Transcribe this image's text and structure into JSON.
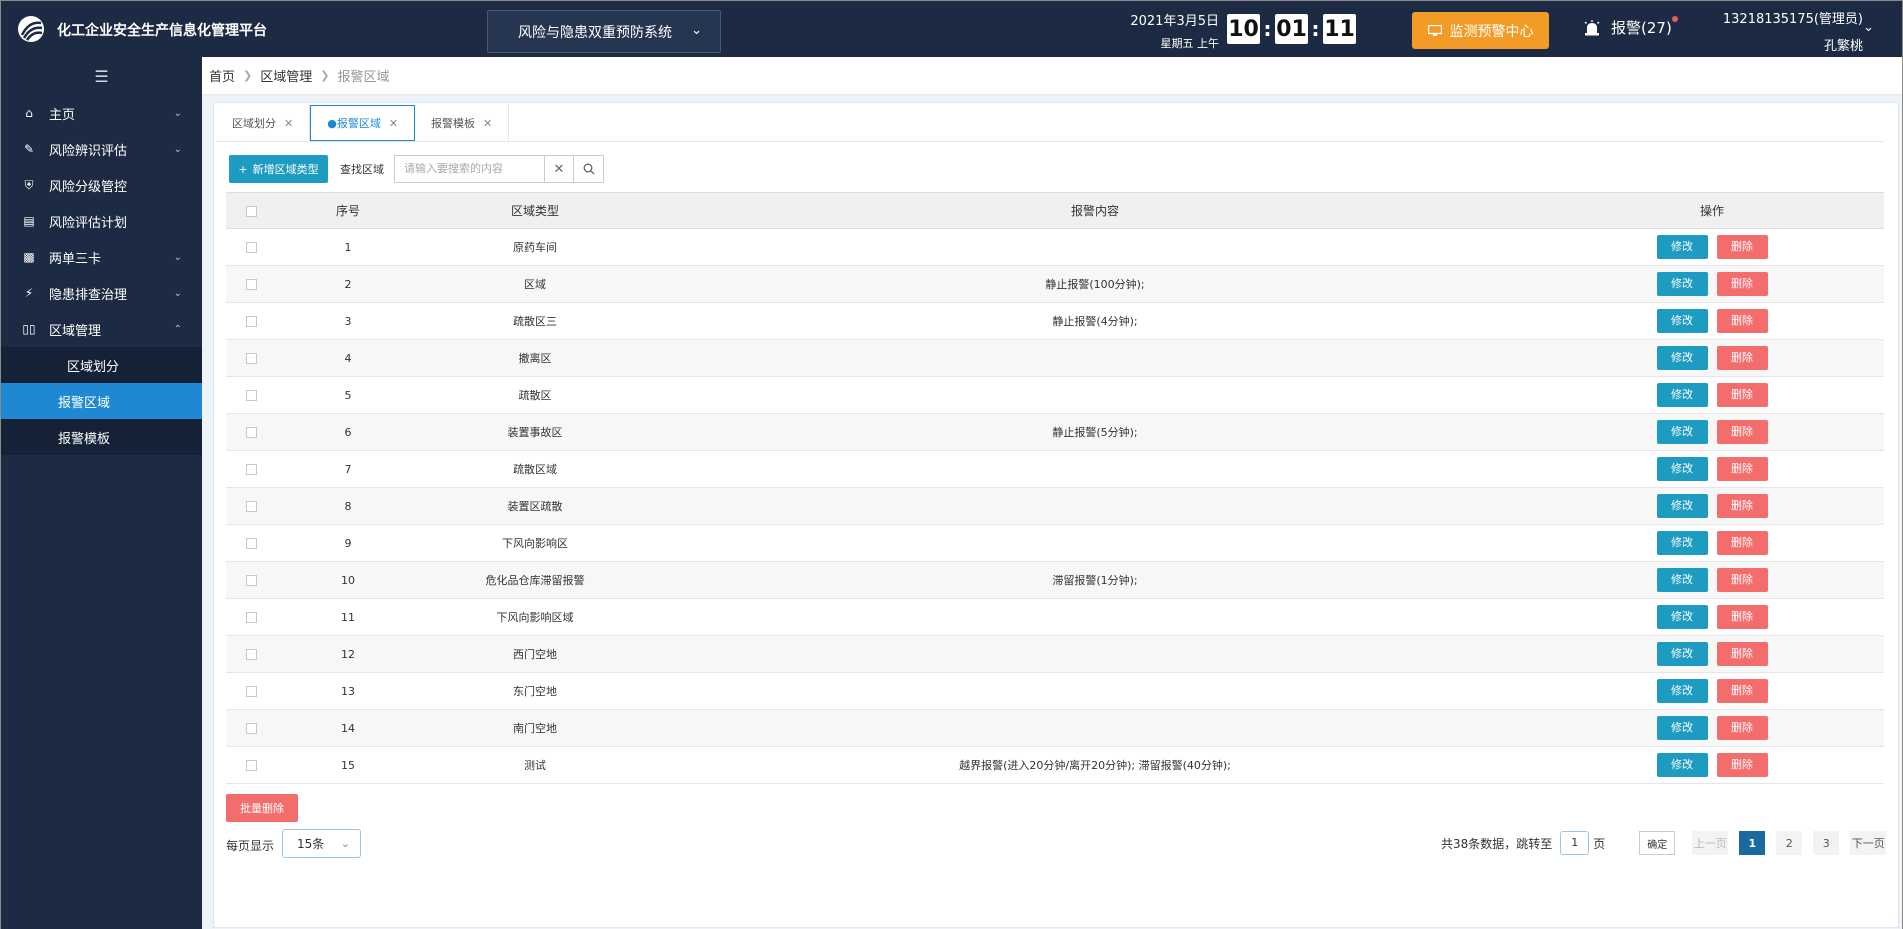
{
  "header": {
    "app_title": "化工企业安全生产信息化管理平台",
    "system_select": "风险与隐患双重预防系统",
    "date": "2021年3月5日",
    "weekday": "星期五 上午",
    "clock": {
      "h": "10",
      "m": "01",
      "s": "11"
    },
    "monitor_button": "监测预警中心",
    "alarm": "报警(27)",
    "user_phone": "13218135175(管理员)",
    "user_name": "孔繁桃"
  },
  "sidebar": {
    "items": [
      {
        "label": "主页",
        "icon": "home-icon"
      },
      {
        "label": "风险辨识评估",
        "icon": "edit-icon"
      },
      {
        "label": "风险分级管控",
        "icon": "shield-icon"
      },
      {
        "label": "风险评估计划",
        "icon": "document-icon"
      },
      {
        "label": "两单三卡",
        "icon": "clipboard-icon"
      },
      {
        "label": "隐患排查治理",
        "icon": "bolt-icon"
      },
      {
        "label": "区域管理",
        "icon": "bars-icon"
      }
    ],
    "sub_items": [
      {
        "label": "区域划分"
      },
      {
        "label": "报警区域"
      },
      {
        "label": "报警模板"
      }
    ]
  },
  "breadcrumb": [
    "首页",
    "区域管理",
    "报警区域"
  ],
  "tabs": [
    {
      "label": "区域划分"
    },
    {
      "label": "●报警区域"
    },
    {
      "label": "报警模板"
    }
  ],
  "toolbar": {
    "add_label": "新增区域类型",
    "find_label": "查找区域",
    "search_placeholder": "请输入要搜索的内容"
  },
  "table": {
    "headers": [
      "序号",
      "区域类型",
      "报警内容",
      "操作"
    ],
    "edit_label": "修改",
    "delete_label": "删除",
    "rows": [
      {
        "no": "1",
        "type": "原药车间",
        "content": ""
      },
      {
        "no": "2",
        "type": "区域",
        "content": "静止报警(100分钟);"
      },
      {
        "no": "3",
        "type": "疏散区三",
        "content": "静止报警(4分钟);"
      },
      {
        "no": "4",
        "type": "撤离区",
        "content": ""
      },
      {
        "no": "5",
        "type": "疏散区",
        "content": ""
      },
      {
        "no": "6",
        "type": "装置事故区",
        "content": "静止报警(5分钟);"
      },
      {
        "no": "7",
        "type": "疏散区域",
        "content": ""
      },
      {
        "no": "8",
        "type": "装置区疏散",
        "content": ""
      },
      {
        "no": "9",
        "type": "下风向影响区",
        "content": ""
      },
      {
        "no": "10",
        "type": "危化品仓库滞留报警",
        "content": "滞留报警(1分钟);"
      },
      {
        "no": "11",
        "type": "下风向影响区域",
        "content": ""
      },
      {
        "no": "12",
        "type": "西门空地",
        "content": ""
      },
      {
        "no": "13",
        "type": "东门空地",
        "content": ""
      },
      {
        "no": "14",
        "type": "南门空地",
        "content": ""
      },
      {
        "no": "15",
        "type": "测试",
        "content": "越界报警(进入20分钟/离开20分钟); 滞留报警(40分钟);"
      }
    ]
  },
  "footer": {
    "batch_delete": "批量删除",
    "per_page_label": "每页显示",
    "per_page_value": "15条",
    "total_text": "共38条数据，跳转至",
    "page_input": "1",
    "page_unit": "页",
    "confirm": "确定",
    "prev": "上一页",
    "pages": [
      "1",
      "2",
      "3"
    ],
    "current_page": "1",
    "next": "下一页"
  },
  "colors": {
    "header_bg": "#1c2b43",
    "accent_blue": "#1e88d2",
    "edit_button": "#1e9bc1",
    "delete_button": "#f36d6d",
    "monitor_button": "#f39b27"
  }
}
